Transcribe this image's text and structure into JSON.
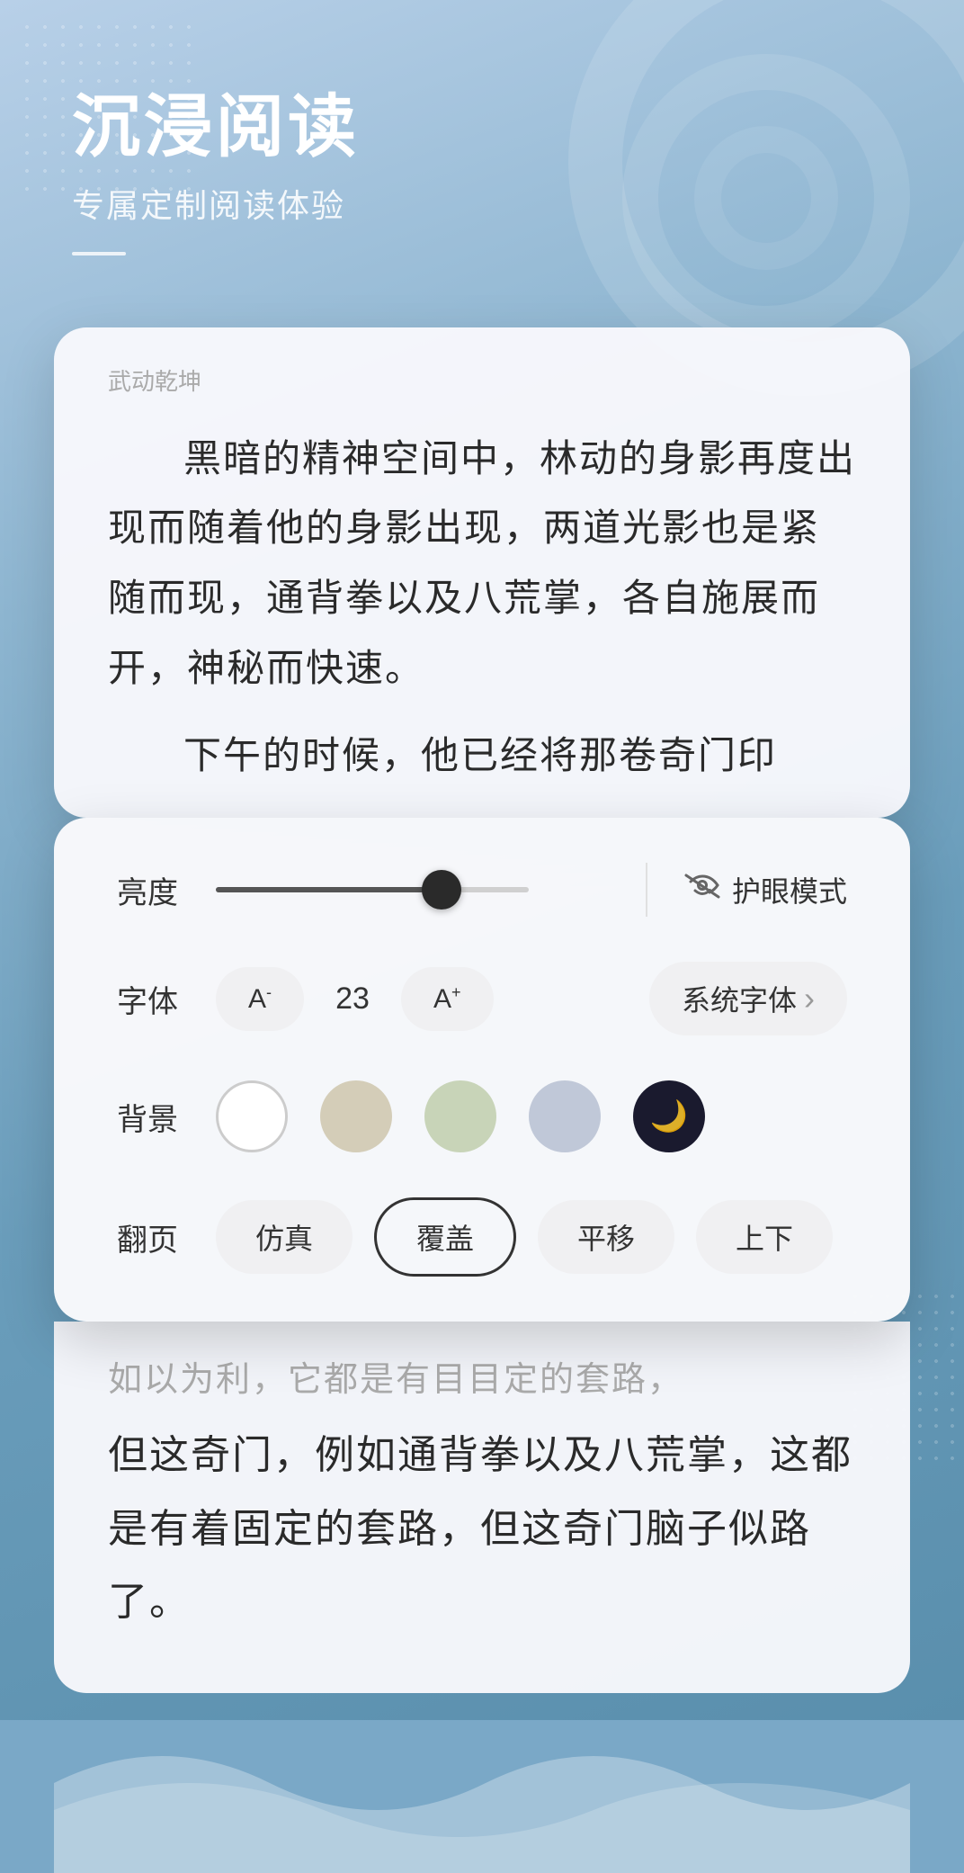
{
  "header": {
    "main_title": "沉浸阅读",
    "sub_title": "专属定制阅读体验"
  },
  "book": {
    "title": "武动乾坤",
    "content_paragraph1": "黑暗的精神空间中，林动的身影再度出现而随着他的身影出现，两道光影也是紧随而现，通背拳以及八荒掌，各自施展而开，神秘而快速。",
    "content_paragraph2": "下午的时候，他已经将那卷奇门印",
    "bottom_text_blurred": "如以为利，它都是有目目定的套路，",
    "bottom_paragraph": "但这奇门，例如通背拳以及八荒掌，这都是有着固定的套路，但这奇门脑子似路了。"
  },
  "settings": {
    "brightness_label": "亮度",
    "brightness_value": 72,
    "eye_mode_label": "护眼模式",
    "font_label": "字体",
    "font_size": 23,
    "font_decrease_label": "A",
    "font_increase_label": "A",
    "font_family_label": "系统字体",
    "font_family_arrow": "›",
    "background_label": "背景",
    "page_turn_label": "翻页",
    "page_turn_options": [
      {
        "id": "simulation",
        "label": "仿真",
        "active": false
      },
      {
        "id": "cover",
        "label": "覆盖",
        "active": true
      },
      {
        "id": "slide",
        "label": "平移",
        "active": false
      },
      {
        "id": "scroll",
        "label": "上下",
        "active": false
      }
    ]
  }
}
